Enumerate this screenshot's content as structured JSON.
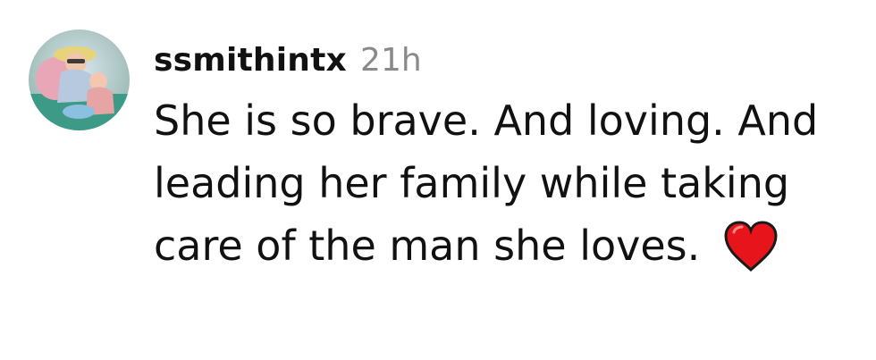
{
  "comment": {
    "username": "ssmithintx",
    "time": "21h",
    "text": "She is so brave. And loving. And leading her family while taking care of the man she loves.",
    "emoji_icon": "red-heart-icon",
    "avatar_icon": "user-photo-avatar"
  },
  "colors": {
    "text": "#111111",
    "timestamp": "#8a8a8a",
    "heart": "#e8141c"
  }
}
